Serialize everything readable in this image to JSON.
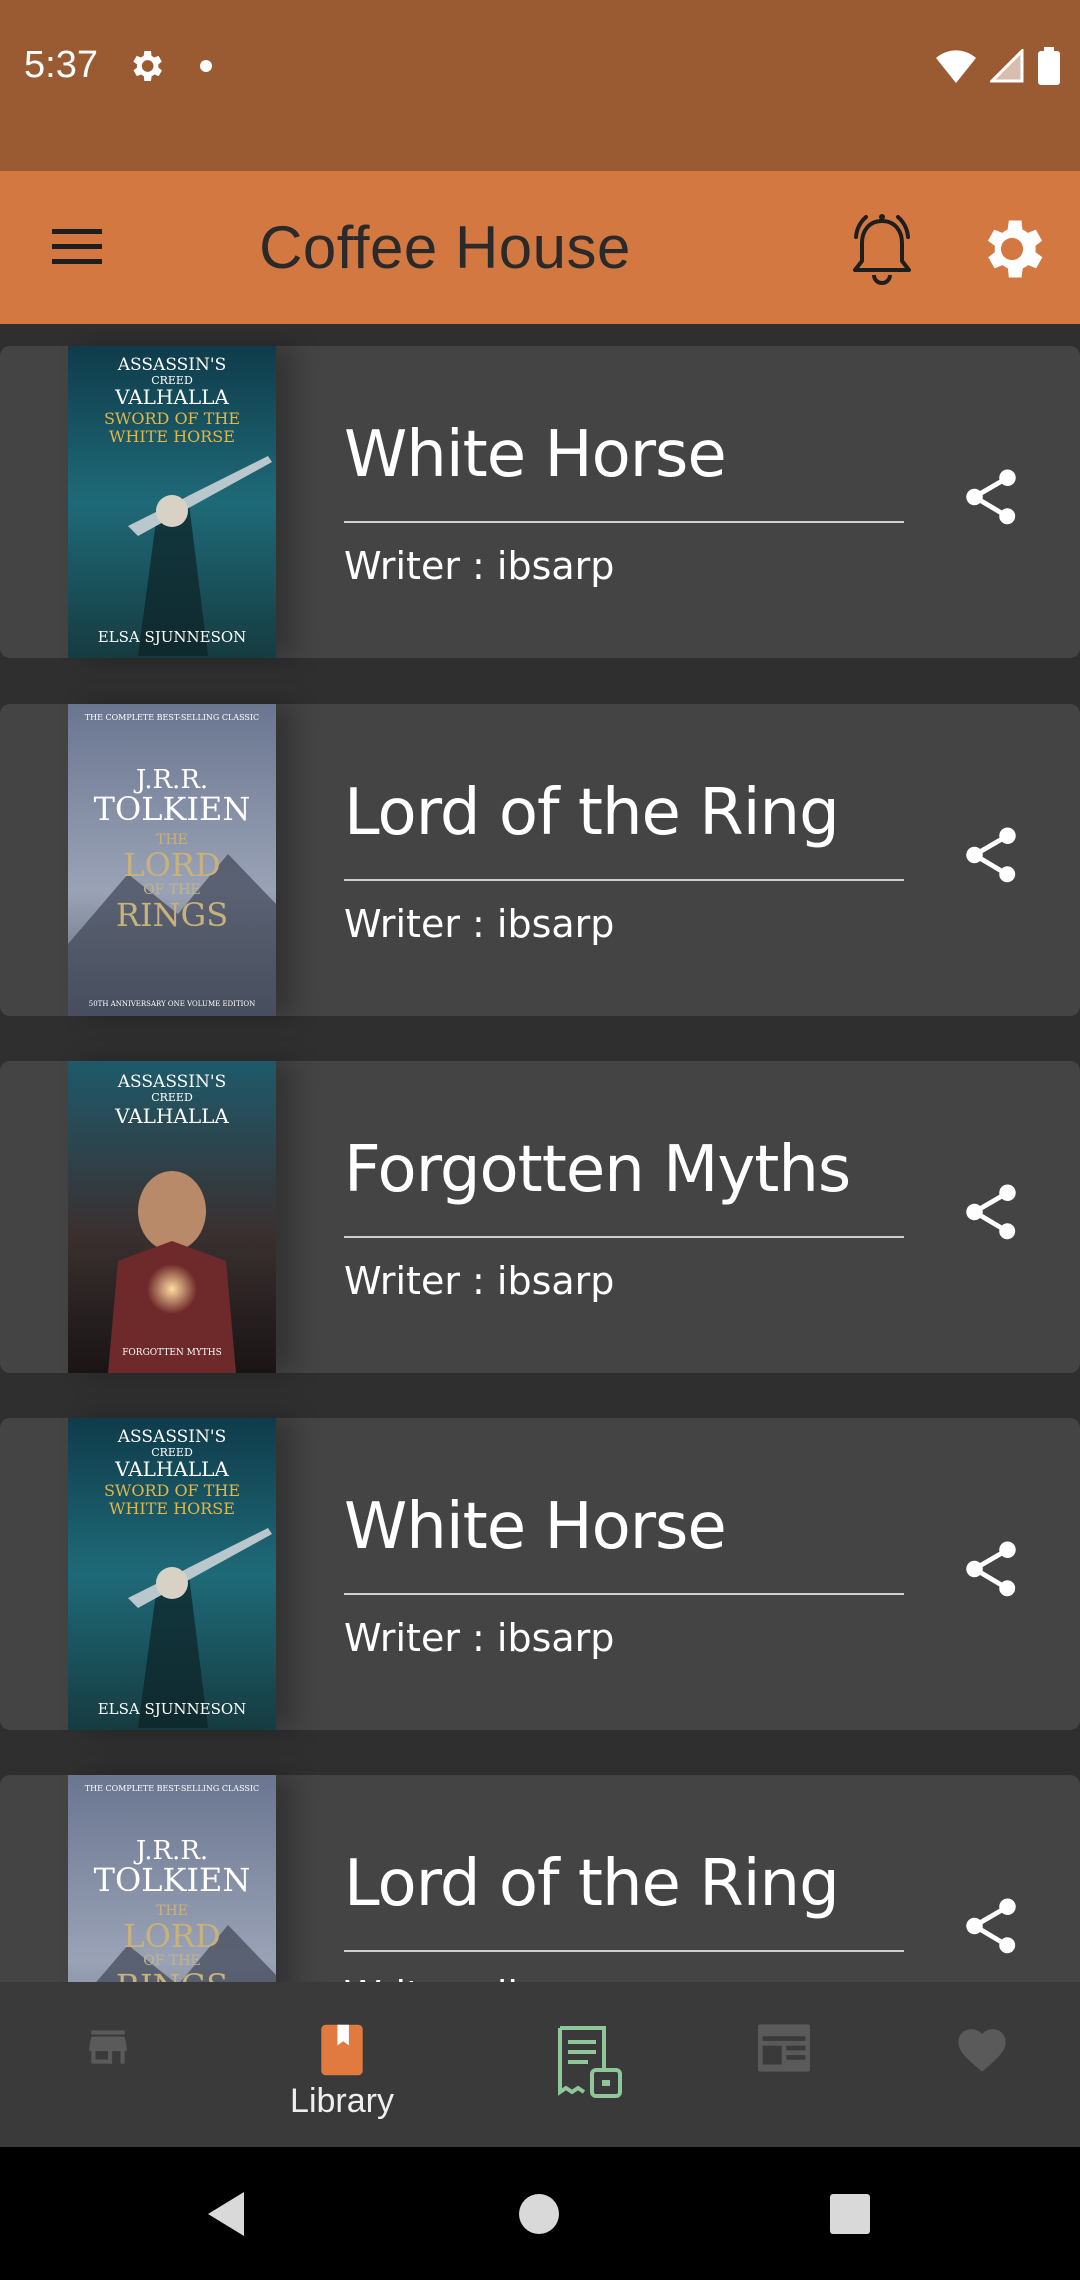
{
  "status": {
    "time": "5:37"
  },
  "app": {
    "title": "Coffee House"
  },
  "books": [
    {
      "title": "White Horse",
      "writer": "Writer : ibsarp",
      "cover": "valhalla-white-horse"
    },
    {
      "title": "Lord of the Ring",
      "writer": "Writer : ibsarp",
      "cover": "lotr"
    },
    {
      "title": "Forgotten Myths",
      "writer": "Writer : ibsarp",
      "cover": "valhalla-forgotten"
    },
    {
      "title": "White Horse",
      "writer": "Writer : ibsarp",
      "cover": "valhalla-white-horse"
    },
    {
      "title": "Lord of the Ring",
      "writer": "Writer : ibsarp",
      "cover": "lotr"
    }
  ],
  "covers": {
    "valhalla_wh": {
      "line1": "ASSASSIN'S",
      "line2": "CREED",
      "line3": "VALHALLA",
      "line4": "SWORD OF THE",
      "line5": "WHITE HORSE",
      "author": "ELSA SJUNNESON"
    },
    "lotr": {
      "top": "THE COMPLETE BEST-SELLING CLASSIC",
      "line1": "J.R.R.",
      "line2": "TOLKIEN",
      "line3": "THE",
      "line4": "LORD",
      "line5": "OF THE",
      "line6": "RINGS",
      "bottom": "50TH ANNIVERSARY ONE VOLUME EDITION"
    },
    "valhalla_fm": {
      "line1": "ASSASSIN'S",
      "line2": "CREED",
      "line3": "VALHALLA",
      "bottom": "FORGOTTEN MYTHS"
    }
  },
  "bottom_nav": {
    "items": [
      {
        "name": "store",
        "label": ""
      },
      {
        "name": "library",
        "label": "Library",
        "active": true
      },
      {
        "name": "receipt",
        "label": ""
      },
      {
        "name": "news",
        "label": ""
      },
      {
        "name": "favorites",
        "label": ""
      }
    ]
  },
  "colors": {
    "status_bar": "#9a5a32",
    "app_bar": "#d27840",
    "background": "#2f2f2f",
    "card": "#444444",
    "accent_active": "#e07a3e",
    "accent_receipt": "#8fc79a"
  }
}
